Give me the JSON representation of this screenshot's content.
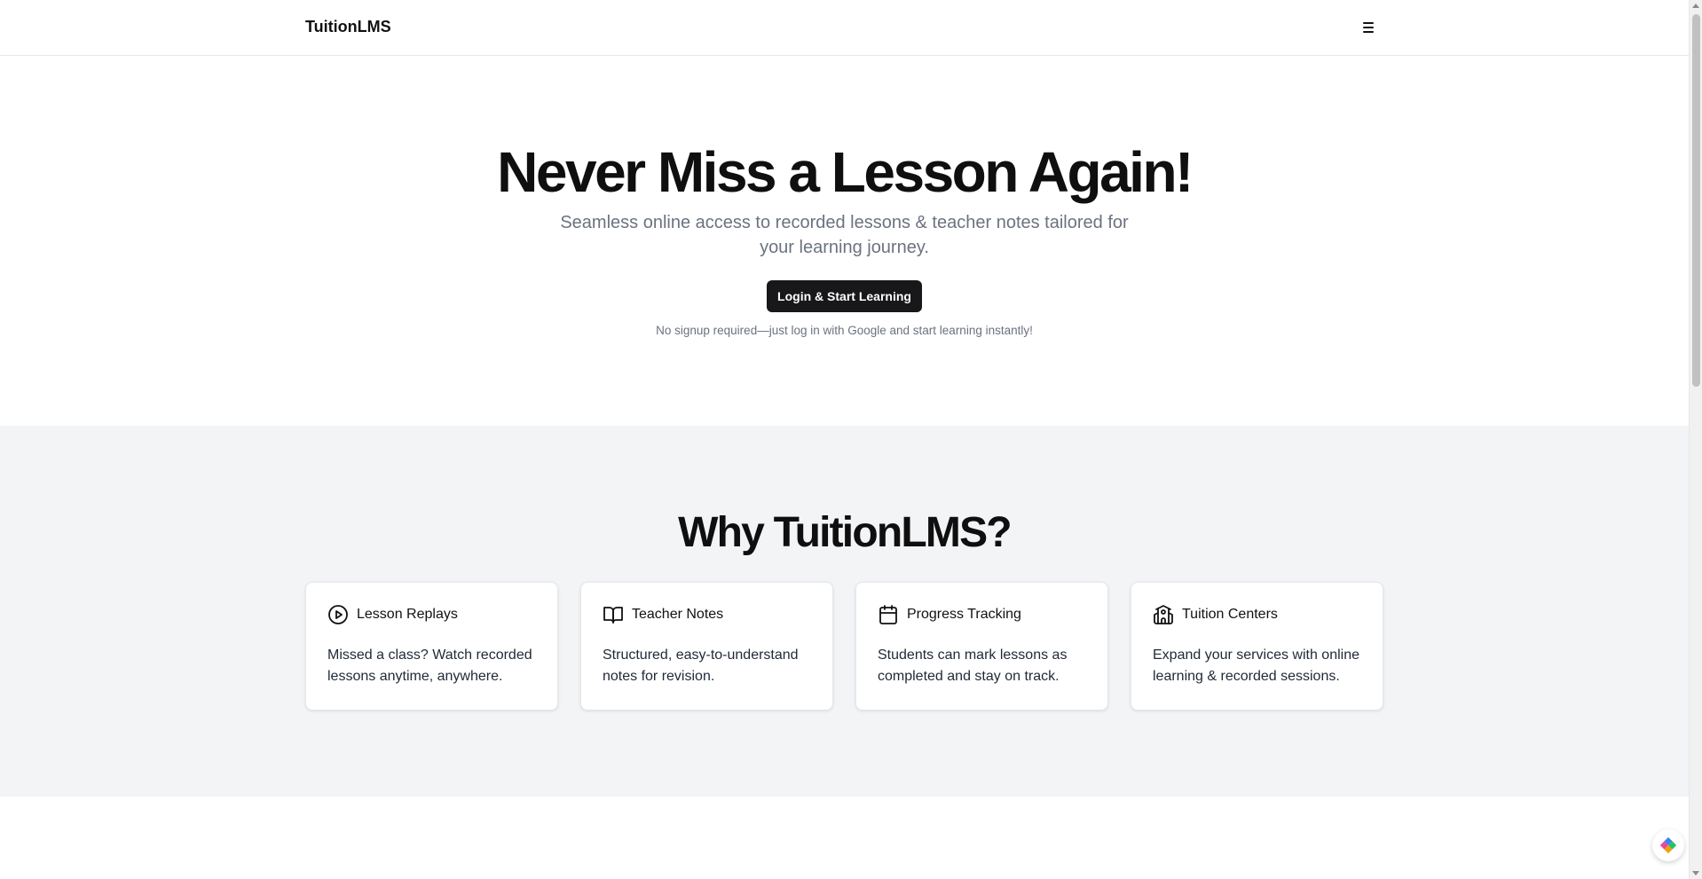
{
  "header": {
    "brand": "TuitionLMS",
    "menu_icon": "hamburger-menu-icon"
  },
  "hero": {
    "title": "Never Miss a Lesson Again!",
    "subtitle": "Seamless online access to recorded lessons & teacher notes tailored for your learning journey.",
    "cta_label": "Login & Start Learning",
    "note": "No signup required—just log in with Google and start learning instantly!"
  },
  "features": {
    "title": "Why TuitionLMS?",
    "cards": [
      {
        "icon": "play-circle-icon",
        "title": "Lesson Replays",
        "description": "Missed a class? Watch recorded lessons anytime, anywhere."
      },
      {
        "icon": "book-open-icon",
        "title": "Teacher Notes",
        "description": "Structured, easy-to-understand notes for revision."
      },
      {
        "icon": "calendar-icon",
        "title": "Progress Tracking",
        "description": "Students can mark lessons as completed and stay on track."
      },
      {
        "icon": "school-icon",
        "title": "Tuition Centers",
        "description": "Expand your services with online learning & recorded sessions."
      }
    ]
  },
  "colors": {
    "primary_button": "#18181b",
    "muted_text": "#6b7280",
    "section_bg": "#f3f4f6"
  },
  "floating_widget": {
    "icon": "diamond-logo-icon"
  }
}
